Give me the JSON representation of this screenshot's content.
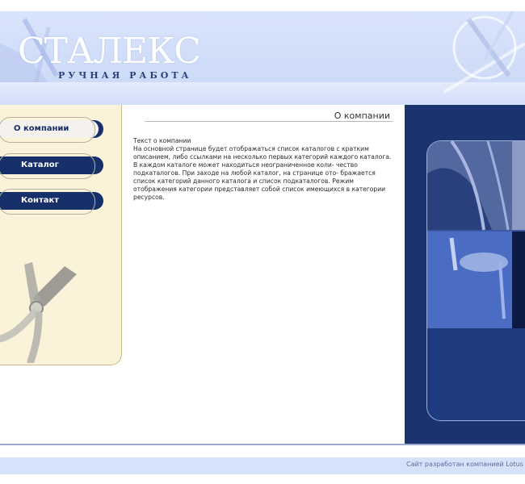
{
  "header": {
    "logo": "СТАЛЕКС",
    "tagline": "РУЧНАЯ РАБОТА"
  },
  "nav": {
    "items": [
      {
        "label": "О компании",
        "active": true
      },
      {
        "label": "Каталог",
        "active": false
      },
      {
        "label": "Контакт",
        "active": false
      }
    ]
  },
  "main": {
    "title": "О компании",
    "heading": "Текст о компании",
    "body": "На основной странице будет отображаться список каталогов с кратким описанием, либо ссылками на несколько первых категорий каждого каталога. В каждом каталоге может находиться неограниченное коли- чество подкаталогов. При заходе на любой каталог, на странице ото- бражается список категорий данного каталога и список подкаталогов. Режим отображения категории представляет собой список имеющихся в категории ресурсов."
  },
  "footer": {
    "credit": "Сайт разработан компанией Lotus"
  },
  "colors": {
    "navy": "#17306a",
    "sidebar_bg": "#fbf3d9",
    "header_bg": "#d9e4fb"
  }
}
